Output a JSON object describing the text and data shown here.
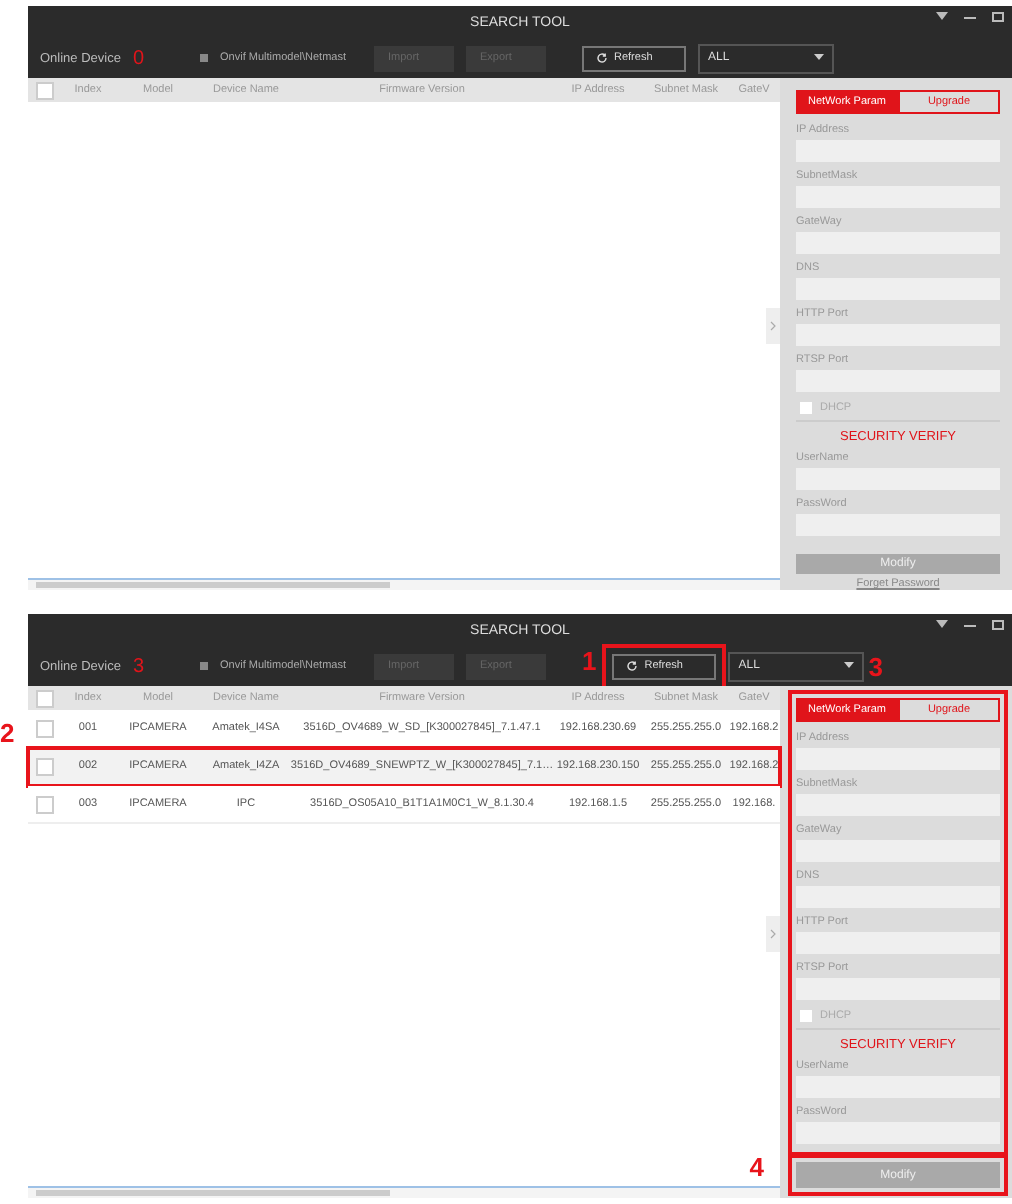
{
  "screens": [
    {
      "title": "SEARCH TOOL",
      "online_label": "Online Device",
      "online_count": "0",
      "onvif_label": "Onvif Multimodel\\Netmast",
      "import_label": "Import",
      "export_label": "Export",
      "refresh": {
        "label": "Refresh"
      },
      "filter": {
        "value": "ALL"
      },
      "select_all_checked": false,
      "columns": [
        "Index",
        "Model",
        "Device Name",
        "Firmware Version",
        "IP Address",
        "Subnet Mask",
        "GateV"
      ],
      "tabs": [
        {
          "label": "NetWork Param",
          "selected": true
        },
        {
          "label": "Upgrade",
          "selected": false
        }
      ],
      "panel": {
        "fields": [
          "IP Address",
          "SubnetMask",
          "GateWay",
          "DNS",
          "HTTP Port",
          "RTSP Port"
        ],
        "dhcp": {
          "label": "DHCP",
          "checked": false
        },
        "security_title": "SECURITY VERIFY",
        "auth_fields": [
          "UserName",
          "PassWord"
        ]
      },
      "modify": {
        "label": "Modify"
      },
      "forgot": "Forget Password"
    },
    {
      "title": "SEARCH TOOL",
      "online_label": "Online Device",
      "online_count": "3",
      "onvif_label": "Onvif Multimodel\\Netmast",
      "import_label": "Import",
      "export_label": "Export",
      "refresh": {
        "label": "Refresh",
        "annotation": "1"
      },
      "filter": {
        "value": "ALL"
      },
      "select_all_checked": false,
      "columns": [
        "Index",
        "Model",
        "Device Name",
        "Firmware Version",
        "IP Address",
        "Subnet Mask",
        "GateV"
      ],
      "rows": [
        {
          "cells": [
            "001",
            "IPCAMERA",
            "Amatek_I4SA",
            "3516D_OV4689_W_SD_[K300027845]_7.1.47.1",
            "192.168.230.69",
            "255.255.255.0",
            "192.168.2"
          ],
          "checked": false,
          "selected": false
        },
        {
          "cells": [
            "002",
            "IPCAMERA",
            "Amatek_I4ZA",
            "3516D_OV4689_SNEWPTZ_W_[K300027845]_7.1…",
            "192.168.230.150",
            "255.255.255.0",
            "192.168.2"
          ],
          "checked": false,
          "selected": true,
          "annotation": "2"
        },
        {
          "cells": [
            "003",
            "IPCAMERA",
            "IPC",
            "3516D_OS05A10_B1T1A1M0C1_W_8.1.30.4",
            "192.168.1.5",
            "255.255.255.0",
            "192.168."
          ],
          "checked": false,
          "selected": false
        }
      ],
      "tabs": [
        {
          "label": "NetWork Param",
          "selected": true
        },
        {
          "label": "Upgrade",
          "selected": false
        }
      ],
      "panel": {
        "annotation": "3",
        "fields": [
          "IP Address",
          "SubnetMask",
          "GateWay",
          "DNS",
          "HTTP Port",
          "RTSP Port"
        ],
        "dhcp": {
          "label": "DHCP",
          "checked": false
        },
        "security_title": "SECURITY VERIFY",
        "auth_fields": [
          "UserName",
          "PassWord"
        ]
      },
      "modify": {
        "label": "Modify",
        "annotation": "4"
      }
    }
  ]
}
